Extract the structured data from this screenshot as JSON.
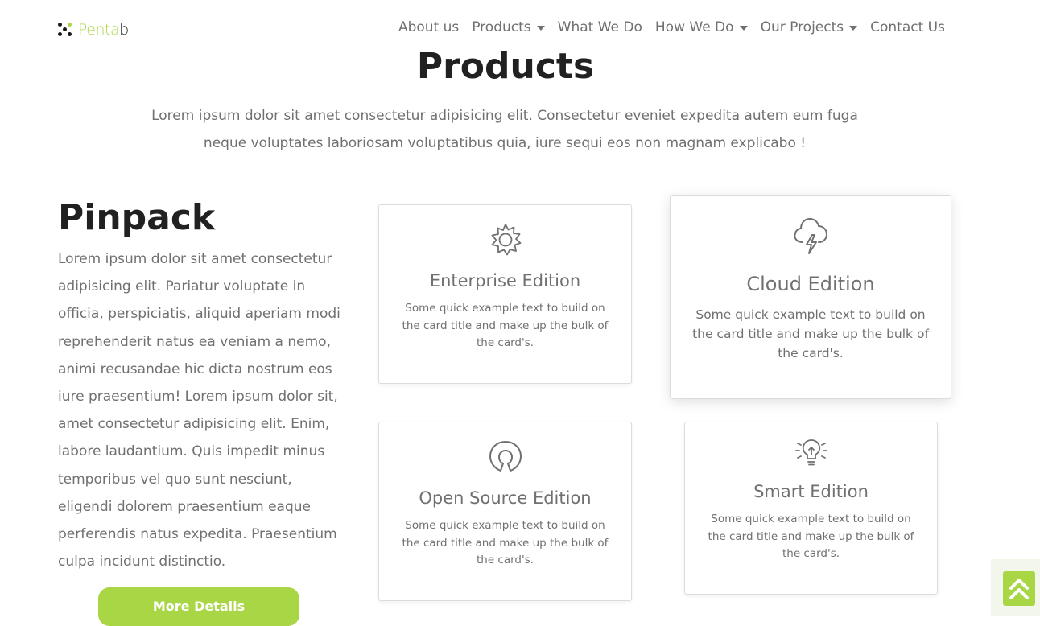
{
  "brand": {
    "name_main": "Penta",
    "name_suffix": "b",
    "accent_color": "#a8d645"
  },
  "nav": {
    "items": [
      {
        "label": "About us",
        "dropdown": false
      },
      {
        "label": "Products",
        "dropdown": true
      },
      {
        "label": "What We Do",
        "dropdown": false
      },
      {
        "label": "How We Do",
        "dropdown": true
      },
      {
        "label": "Our Projects",
        "dropdown": true
      },
      {
        "label": "Contact Us",
        "dropdown": false
      }
    ]
  },
  "header": {
    "title": "Products",
    "intro": "Lorem ipsum dolor sit amet consectetur adipisicing elit. Consectetur eveniet expedita autem eum fuga neque voluptates laboriosam voluptatibus quia, iure sequi eos non magnam explicabo !"
  },
  "product": {
    "name": "Pinpack",
    "description": "Lorem ipsum dolor sit amet consectetur adipisicing elit. Pariatur voluptate in officia, perspiciatis, aliquid aperiam modi reprehenderit natus ea veniam a nemo, animi recusandae hic dicta nostrum eos iure praesentium! Lorem ipsum dolor sit, amet consectetur adipisicing elit. Enim, labore laudantium. Quis impedit minus temporibus vel quo sunt nesciunt, eligendi dolorem praesentium eaque perferendis natus expedita. Praesentium culpa incidunt distinctio.",
    "button_label": "More Details"
  },
  "cards": [
    {
      "icon": "sun-gear-icon",
      "title": "Enterprise Edition",
      "text": "Some quick example text to build on the card title and make up the bulk of the card's."
    },
    {
      "icon": "cloud-lightning-icon",
      "title": "Cloud Edition",
      "text": "Some quick example text to build on the card title and make up the bulk of the card's."
    },
    {
      "icon": "open-source-icon",
      "title": "Open Source Edition",
      "text": "Some quick example text to build on the card title and make up the bulk of the card's."
    },
    {
      "icon": "lightbulb-icon",
      "title": "Smart Edition",
      "text": "Some quick example text to build on the card title and make up the bulk of the card's."
    }
  ],
  "scroll_top": {
    "icon": "double-chevron-up-icon"
  }
}
